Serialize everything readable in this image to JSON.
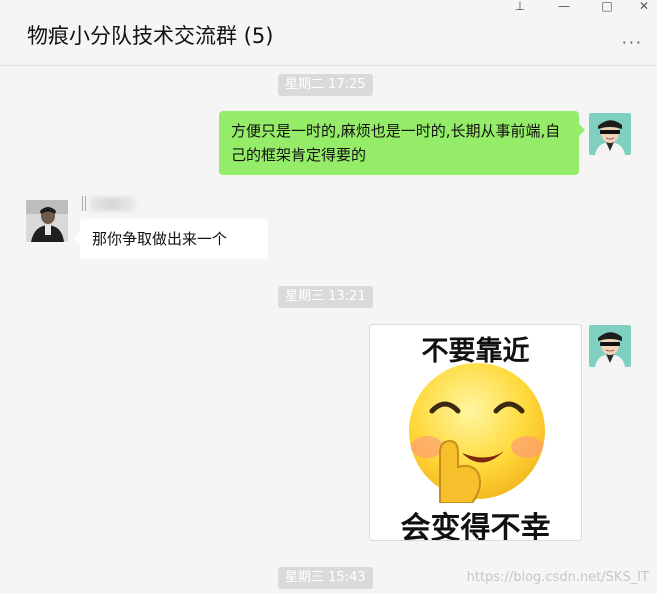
{
  "window": {
    "title": "物痕小分队技术交流群 (5)",
    "controls": {
      "pin": "⊥",
      "minimize": "—",
      "maximize": "□",
      "close": "✕"
    },
    "more": "···"
  },
  "messages": [
    {
      "kind": "time",
      "text": "星期二 17:25"
    },
    {
      "kind": "text",
      "side": "mine",
      "text": "方便只是一时的,麻烦也是一时的,长期从事前端,自己的框架肯定得要的"
    },
    {
      "kind": "text",
      "side": "theirs",
      "text": "那你争取做出来一个"
    },
    {
      "kind": "time",
      "text": "星期三 13:21"
    },
    {
      "kind": "sticker",
      "side": "mine",
      "top_text": "不要靠近",
      "bottom_text": "会变得不幸"
    },
    {
      "kind": "time",
      "text": "星期三 15:43"
    }
  ],
  "watermark": "https://blog.csdn.net/SKS_IT",
  "colors": {
    "mine_bubble": "#95ec69",
    "theirs_bubble": "#ffffff",
    "background": "#f5f5f5",
    "time_badge": "#dadada"
  }
}
